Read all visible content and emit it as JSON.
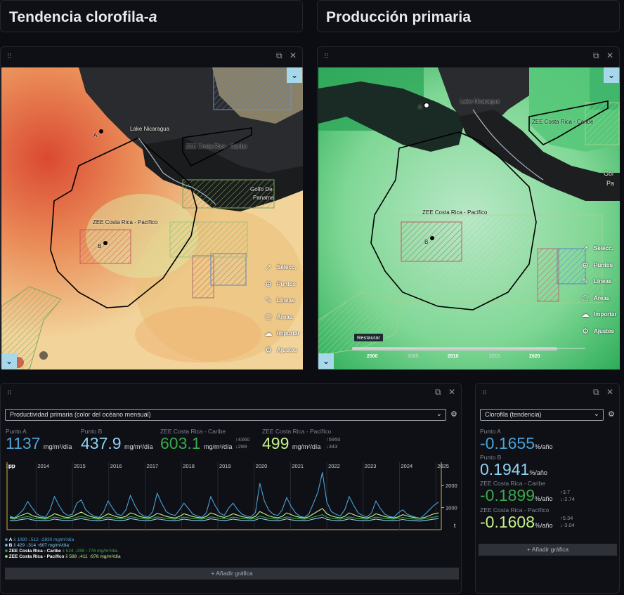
{
  "headers": {
    "chl_title_main": "Tendencia clorofila-",
    "chl_title_italic": "a",
    "pp_title": "Producción primaria"
  },
  "icons": {
    "drag": "drag-handle-icon",
    "popout": "popout-icon",
    "close": "close-icon",
    "chevron": "chevron-down-icon",
    "gear": "gear-icon"
  },
  "map_labels": {
    "lake": "Lake Nicaragua",
    "zee_caribe": "ZEE Costa Rica - Caribe",
    "zee_pacifico": "ZEE Costa Rica - Pacífico",
    "point_a": "A",
    "point_b": "B",
    "golfo": "Golfo De",
    "panama": "Panama",
    "golfo_short": "Gol",
    "panama_short": "Pa"
  },
  "tools": [
    {
      "label": "Selecc.",
      "icon": "cursor-icon"
    },
    {
      "label": "Puntos",
      "icon": "crosshair-icon"
    },
    {
      "label": "Líneas",
      "icon": "line-icon"
    },
    {
      "label": "Áreas",
      "icon": "polygon-icon"
    },
    {
      "label": "Importar",
      "icon": "cloud-upload-icon"
    },
    {
      "label": "Ajustes",
      "icon": "gear-icon"
    }
  ],
  "timeline": {
    "restore": "Restaurar",
    "years": [
      "2000",
      "2005",
      "2010",
      "2015",
      "2020"
    ]
  },
  "prod_panel": {
    "select": "Productividad primaria (color del océano mensual)",
    "unit": "mg/m²/día",
    "stats": [
      {
        "name": "Punto A",
        "value": "1137",
        "color": "#4da2d6"
      },
      {
        "name": "Punto B",
        "value": "437.9",
        "color": "#8fd0f2"
      },
      {
        "name": "ZEE Costa Rica - Caribe",
        "value": "603.1",
        "color": "#3aa84a",
        "up": "↑4360",
        "down": "↓289"
      },
      {
        "name": "ZEE Costa Rica - Pacífico",
        "value": "499",
        "color": "#c6f08a",
        "up": "↑5950",
        "down": "↓343"
      }
    ],
    "y_label": "pp",
    "x_label": "t",
    "years": [
      "2013",
      "2014",
      "2015",
      "2016",
      "2017",
      "2018",
      "2019",
      "2020",
      "2021",
      "2022",
      "2023",
      "2024",
      "2025"
    ],
    "y_ticks": [
      "2000",
      "1000"
    ],
    "legend": [
      {
        "key": "A",
        "text": "x̄ 1080  ↓512  ↑2830 mg/m²/día",
        "color": "#4da2d6"
      },
      {
        "key": "B",
        "text": "x̄ 429  ↓314  ↑607 mg/m²/día",
        "color": "#8fd0f2"
      },
      {
        "key": "ZEE Costa Rica - Caribe",
        "text": "x̄ 524  ↓259  ↑776 mg/m²/día",
        "color": "#3aa84a"
      },
      {
        "key": "ZEE Costa Rica - Pacífico",
        "text": "x̄ 588  ↓411  ↑976 mg/m²/día",
        "color": "#c6f08a"
      }
    ],
    "add": "+ Añadir gráfica"
  },
  "chl_panel": {
    "select": "Clorofila (tendencia)",
    "unit": "%/año",
    "stats": [
      {
        "name": "Punto A",
        "value": "-0.1655",
        "color": "#4da2d6"
      },
      {
        "name": "Punto B",
        "value": "0.1941",
        "color": "#8fd0f2"
      },
      {
        "name": "ZEE Costa Rica - Caribe",
        "value": "-0.1899",
        "color": "#3aa84a",
        "up": "↑3.7",
        "down": "↓-2.74"
      },
      {
        "name": "ZEE Costa Rica - Pacífico",
        "value": "-0.1608",
        "color": "#c6f08a",
        "up": "↑5.34",
        "down": "↓-3.04"
      }
    ],
    "add": "+ Añadir gráfica"
  },
  "chart_data": {
    "type": "line",
    "x_range": [
      "2013",
      "2025"
    ],
    "ylabel": "pp",
    "xlabel": "t",
    "yticks": [
      1000,
      2000
    ],
    "series": [
      {
        "name": "A",
        "color": "#4da2d6",
        "values": [
          620,
          540,
          700,
          900,
          1280,
          980,
          720,
          610,
          560,
          900,
          1500,
          1100,
          780,
          640,
          700,
          1200,
          1350,
          900,
          720,
          600,
          560,
          800,
          1300,
          980,
          700,
          640,
          900,
          1550,
          1100,
          760,
          620,
          580,
          820,
          1650,
          1200,
          820,
          700,
          640,
          900,
          1200,
          950,
          700,
          620,
          560,
          760,
          1500,
          1080,
          760,
          640,
          980,
          1200,
          900,
          700,
          620,
          580,
          780,
          2100,
          1300,
          880,
          700,
          640,
          900,
          1450,
          1050,
          760,
          600,
          560,
          720,
          1200,
          1700,
          2600,
          1250,
          820,
          700,
          620,
          900,
          1500,
          1100,
          760,
          640,
          580,
          760,
          1300,
          950,
          700,
          600,
          560,
          760,
          900,
          700,
          620,
          560,
          520,
          700,
          900,
          1100,
          1250
        ]
      },
      {
        "name": "B",
        "color": "#8fd0f2",
        "values": [
          420,
          400,
          440,
          470,
          500,
          450,
          420,
          410,
          400,
          430,
          480,
          450,
          420,
          410,
          430,
          470,
          500,
          460,
          430,
          410,
          400,
          440,
          480,
          450,
          420,
          410,
          440,
          500,
          470,
          430,
          410,
          400,
          440,
          490,
          460,
          430,
          410,
          400,
          440,
          480,
          450,
          420,
          410,
          400,
          440,
          490,
          460,
          430,
          410,
          440,
          480,
          450,
          420,
          410,
          400,
          440,
          520,
          470,
          430,
          410,
          400,
          440,
          490,
          450,
          420,
          410,
          400,
          430,
          480,
          520,
          560,
          470,
          430,
          410,
          400,
          440,
          490,
          450,
          420,
          410,
          400,
          440,
          480,
          450,
          420,
          410,
          400,
          430,
          460,
          430,
          410,
          400,
          390,
          420,
          450,
          480,
          500
        ]
      },
      {
        "name": "ZEE Costa Rica - Caribe",
        "color": "#3aa84a",
        "values": [
          500,
          480,
          520,
          560,
          600,
          540,
          500,
          490,
          480,
          510,
          570,
          540,
          500,
          490,
          510,
          560,
          600,
          550,
          510,
          490,
          480,
          520,
          570,
          540,
          500,
          490,
          520,
          590,
          560,
          510,
          490,
          480,
          520,
          580,
          550,
          510,
          490,
          480,
          520,
          570,
          540,
          500,
          490,
          480,
          520,
          580,
          550,
          510,
          490,
          520,
          570,
          540,
          500,
          490,
          480,
          520,
          620,
          560,
          510,
          490,
          480,
          520,
          580,
          540,
          500,
          490,
          480,
          510,
          570,
          620,
          680,
          560,
          510,
          490,
          480,
          520,
          580,
          540,
          500,
          490,
          480,
          520,
          570,
          540,
          500,
          490,
          480,
          510,
          550,
          510,
          490,
          480,
          470,
          500,
          540,
          570,
          600
        ]
      },
      {
        "name": "ZEE Costa Rica - Pacífico",
        "color": "#c6f08a",
        "values": [
          560,
          520,
          600,
          680,
          760,
          640,
          580,
          550,
          520,
          600,
          720,
          660,
          580,
          550,
          600,
          700,
          800,
          680,
          600,
          550,
          520,
          600,
          720,
          650,
          580,
          550,
          600,
          760,
          700,
          600,
          560,
          530,
          600,
          740,
          680,
          600,
          560,
          530,
          600,
          720,
          660,
          590,
          560,
          530,
          600,
          760,
          690,
          600,
          560,
          620,
          720,
          660,
          590,
          560,
          530,
          600,
          820,
          720,
          620,
          570,
          540,
          600,
          760,
          680,
          600,
          560,
          530,
          590,
          720,
          840,
          960,
          720,
          620,
          570,
          540,
          600,
          760,
          680,
          600,
          560,
          530,
          600,
          720,
          660,
          590,
          560,
          530,
          580,
          680,
          620,
          570,
          540,
          520,
          560,
          640,
          720,
          760
        ]
      }
    ]
  }
}
